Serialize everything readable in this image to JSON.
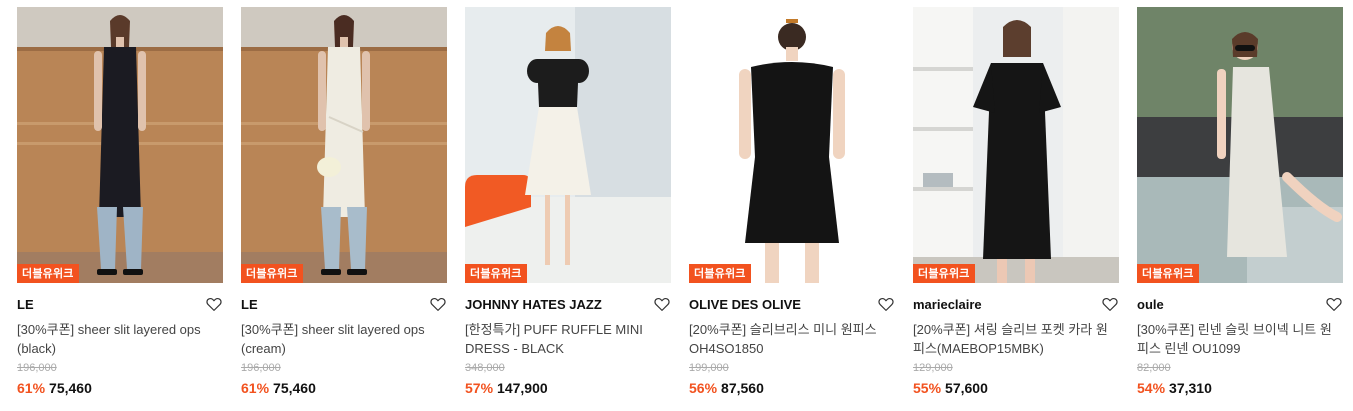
{
  "badge_label": "더블유위크",
  "accent_color": "#f2521f",
  "products": [
    {
      "brand": "LE",
      "name": "[30%쿠폰] sheer slit layered ops (black)",
      "original_price": "196,000",
      "discount": "61%",
      "price": "75,460",
      "icon": "heart-icon"
    },
    {
      "brand": "LE",
      "name": "[30%쿠폰] sheer slit layered ops (cream)",
      "original_price": "196,000",
      "discount": "61%",
      "price": "75,460",
      "icon": "heart-icon"
    },
    {
      "brand": "JOHNNY HATES JAZZ",
      "name": "[한정특가] PUFF RUFFLE MINI DRESS - BLACK",
      "original_price": "348,000",
      "discount": "57%",
      "price": "147,900",
      "icon": "heart-icon"
    },
    {
      "brand": "OLIVE DES OLIVE",
      "name": "[20%쿠폰] 슬리브리스 미니 원피스 OH4SO1850",
      "original_price": "199,000",
      "discount": "56%",
      "price": "87,560",
      "icon": "heart-icon"
    },
    {
      "brand": "marieclaire",
      "name": "[20%쿠폰] 셔링 슬리브 포켓 카라 원피스(MAEBOP15MBK)",
      "original_price": "129,000",
      "discount": "55%",
      "price": "57,600",
      "icon": "heart-icon"
    },
    {
      "brand": "oule",
      "name": "[30%쿠폰] 린넨 슬릿 브이넥 니트 원피스 린넨 OU1099",
      "original_price": "82,000",
      "discount": "54%",
      "price": "37,310",
      "icon": "heart-icon"
    }
  ]
}
